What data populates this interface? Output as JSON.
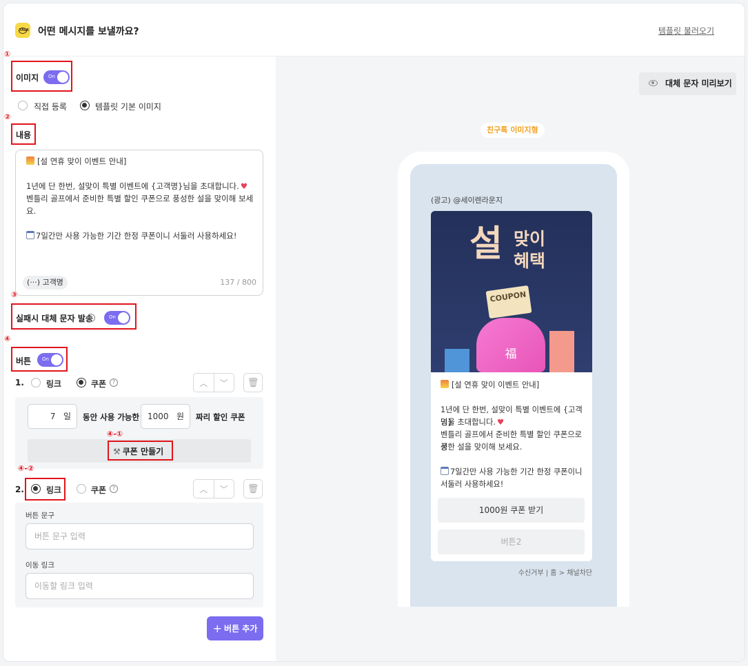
{
  "header": {
    "title": "어떤 메시지를 보낼까요?",
    "template_link": "템플릿 불러오기"
  },
  "annotations": {
    "n1": "①",
    "n2": "②",
    "n3": "③",
    "n4": "④",
    "n41": "④-①",
    "n42": "④-②"
  },
  "image_section": {
    "label": "이미지",
    "toggle": "On",
    "option_direct": "직접 등록",
    "option_template": "템플릿 기본 이미지"
  },
  "content_section": {
    "label": "내용",
    "line1": "[설 연휴 맞이 이벤트 안내]",
    "line2": "1년에 단 한번, 설맞이 특별 이벤트에 {고객명}님을 초대합니다.",
    "line3": "벤틀리 골프에서 준비한 특별 할인 쿠폰으로 풍성한 설을 맞이해 보세요.",
    "line4": "7일간만 사용 가능한 기간 한정 쿠폰이니 서둘러 사용하세요!",
    "chip": "(···) 고객명",
    "counter": "137 / 800"
  },
  "fallback": {
    "label": "실패시 대체 문자 발송",
    "toggle": "On"
  },
  "buttons_section": {
    "label": "버튼",
    "toggle": "On",
    "b1": {
      "num": "1.",
      "link": "링크",
      "coupon": "쿠폰",
      "days": "7",
      "days_unit": "일",
      "mid_text": "동안 사용 가능한",
      "amount": "1000",
      "amount_unit": "원",
      "end_text": "짜리 할인 쿠폰",
      "make_coupon": "쿠폰 만들기"
    },
    "b2": {
      "num": "2.",
      "link": "링크",
      "coupon": "쿠폰",
      "text_label": "버튼 문구",
      "text_placeholder": "버튼 문구 입력",
      "url_label": "이동 링크",
      "url_placeholder": "이동할 링크 입력"
    },
    "add_button": "버튼 추가"
  },
  "preview": {
    "alt_preview_button": "대체 문자 미리보기",
    "type_chip": "친구톡 이미지형",
    "sender": "(광고) @세이렌라운지",
    "banner_title": "설",
    "banner_sub1": "맞이",
    "banner_sub2": "혜택",
    "coupon_text": "COUPON",
    "bag_char": "福",
    "body_line1": "[설 연휴 맞이 이벤트 안내]",
    "body_line2": "1년에 단 한번, 설맞이 특별 이벤트에 {고객명}",
    "body_line3": "님을 초대합니다.",
    "body_line4": "벤틀리 골프에서 준비한 특별 할인 쿠폰으로 풍",
    "body_line5": "성한 설을 맞이해 보세요.",
    "body_line6": "7일간만 사용 가능한 기간 한정 쿠폰이니",
    "body_line7": "서둘러 사용하세요!",
    "btn1": "1000원 쿠폰 받기",
    "btn2": "버튼2",
    "footer": "수신거부 | 홈 > 채널차단"
  },
  "colors": {
    "accent": "#7b6cf0",
    "annotation_red": "#e0141b",
    "chip_orange": "#f0a020"
  }
}
